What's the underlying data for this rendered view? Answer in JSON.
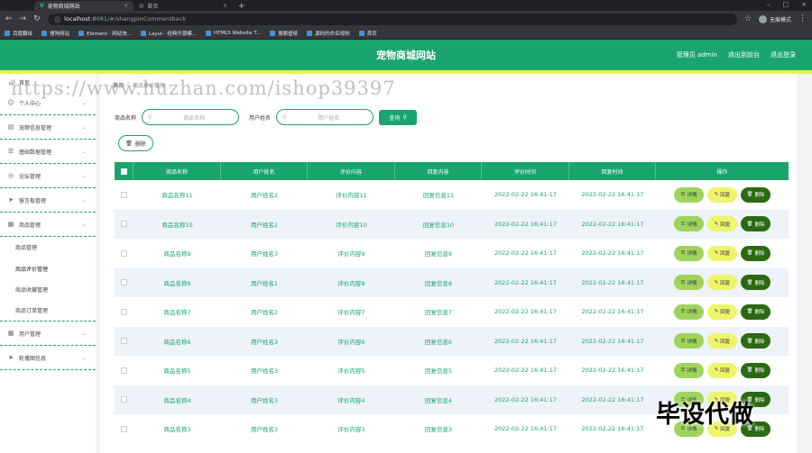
{
  "browser": {
    "tabs": [
      {
        "title": "宠物商城网站",
        "active": true
      },
      {
        "title": "首页",
        "active": false
      }
    ],
    "url_host": "localhost",
    "url_path": ":8081/#/shangpinCommentback",
    "profile": "无痕模式",
    "bookmarks": [
      "百度翻译",
      "搜狗网站",
      "Element - 网站快...",
      "Layui - 经典开源模...",
      "HTML5 Website T...",
      "搜索壁纸",
      "源码的命名规则",
      "首页"
    ]
  },
  "header": {
    "title": "宠物商城网站",
    "links": [
      "管理员 admin",
      "退出到前台",
      "退出登录"
    ]
  },
  "sidebar": {
    "home": "首页",
    "items": [
      {
        "label": "个人中心",
        "icon": "user-icon"
      },
      {
        "label": "宠粮信息管理",
        "icon": "document-icon"
      },
      {
        "label": "基础数据管理",
        "icon": "list-icon"
      },
      {
        "label": "论坛管理",
        "icon": "compass-icon"
      },
      {
        "label": "留言板管理",
        "icon": "send-icon"
      },
      {
        "label": "商品管理",
        "icon": "grid-icon"
      }
    ],
    "sub_items": [
      "商品管理",
      "商品评价管理",
      "商品收藏管理",
      "商品订单管理"
    ],
    "items_after": [
      {
        "label": "用户管理",
        "icon": "grid-icon"
      },
      {
        "label": "轮播图信息",
        "icon": "send-icon"
      }
    ]
  },
  "breadcrumb": {
    "home": "首页",
    "sep": "/",
    "current": "商品评价管理"
  },
  "search": {
    "label1": "商品名称",
    "placeholder1": "商品名称",
    "label2": "用户姓名",
    "placeholder2": "用户姓名",
    "button": "查询"
  },
  "actions": {
    "delete": "删除"
  },
  "table": {
    "headers": [
      "商品名称",
      "用户姓名",
      "评价内容",
      "回复内容",
      "评价时间",
      "回复时间",
      "操作"
    ],
    "op_labels": {
      "detail": "详情",
      "reply": "回复",
      "delete": "删除"
    },
    "rows": [
      [
        "商品名称11",
        "用户姓名2",
        "评价内容11",
        "回复信息11",
        "2022-02-22 16:41:17",
        "2022-02-22 16:41:17"
      ],
      [
        "商品名称10",
        "用户姓名2",
        "评价内容10",
        "回复信息10",
        "2022-02-22 16:41:17",
        "2022-02-22 16:41:17"
      ],
      [
        "商品名称9",
        "用户姓名3",
        "评价内容9",
        "回复信息9",
        "2022-02-22 16:41:17",
        "2022-02-22 16:41:17"
      ],
      [
        "商品名称8",
        "用户姓名1",
        "评价内容8",
        "回复信息8",
        "2022-02-22 16:41:17",
        "2022-02-22 16:41:17"
      ],
      [
        "商品名称7",
        "用户姓名2",
        "评价内容7",
        "回复信息7",
        "2022-02-22 16:41:17",
        "2022-02-22 16:41:17"
      ],
      [
        "商品名称6",
        "用户姓名3",
        "评价内容6",
        "回复信息6",
        "2022-02-22 16:41:17",
        "2022-02-22 16:41:17"
      ],
      [
        "商品名称5",
        "用户姓名3",
        "评价内容5",
        "回复信息5",
        "2022-02-22 16:41:17",
        "2022-02-22 16:41:17"
      ],
      [
        "商品名称4",
        "用户姓名3",
        "评价内容4",
        "回复信息4",
        "2022-02-22 16:41:17",
        "2022-02-22 16:41:17"
      ],
      [
        "商品名称3",
        "用户姓名3",
        "评价内容3",
        "回复信息3",
        "2022-02-22 16:41:17",
        "2022-02-22 16:41:17"
      ]
    ]
  },
  "overlay": {
    "watermark": "https://www.huzhan.com/ishop39397",
    "stamp": "毕设代做"
  },
  "colors": {
    "primary": "#1aa46e",
    "strip": "#e8f24a",
    "detail": "#9ed45a",
    "reply": "#eef56a",
    "delete": "#2b6a12"
  }
}
